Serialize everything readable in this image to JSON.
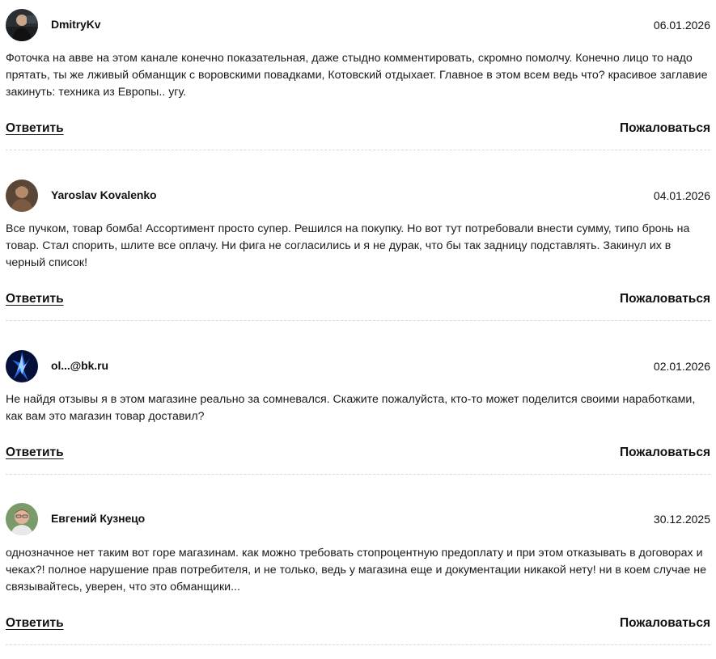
{
  "comments": [
    {
      "author": "DmitryKv",
      "date": "06.01.2026",
      "text": "Фоточка на авве на этом канале конечно показательная, даже стыдно комментировать, скромно помолчу. Конечно лицо то надо прятать, ты же лживый обманщик с воровскими повадками, Котовский отдыхает. Главное в этом всем ведь что? красивое заглавие закинуть: техника из Европы.. угу.",
      "reply_label": "Ответить",
      "report_label": "Пожаловаться"
    },
    {
      "author": "Yaroslav Kovalenko",
      "date": "04.01.2026",
      "text": "Все пучком, товар бомба! Ассортимент просто супер. Решился на покупку. Но вот тут потребовали внести сумму, типо бронь на товар. Стал спорить, шлите все оплачу. Ни фига не согласились и я не дурак, что бы так задницу подставлять. Закинул их в черный список!",
      "reply_label": "Ответить",
      "report_label": "Пожаловаться"
    },
    {
      "author": "ol...@bk.ru",
      "date": "02.01.2026",
      "text": "Не найдя отзывы я в этом магазине реально за сомневался. Скажите пожалуйста, кто-то может поделится своими наработками, как вам это магазин товар доставил?",
      "reply_label": "Ответить",
      "report_label": "Пожаловаться"
    },
    {
      "author": "Евгений Кузнецо",
      "date": "30.12.2025",
      "text": "однозначное нет таким вот горе магазинам. как можно требовать стопроцентную предоплату и при этом отказывать в договорах и чеках?! полное нарушение прав потребителя, и не только, ведь у магазина еще и документации никакой нету! ни в коем случае не связывайтесь, уверен, что это обманщики...",
      "reply_label": "Ответить",
      "report_label": "Пожаловаться"
    }
  ]
}
